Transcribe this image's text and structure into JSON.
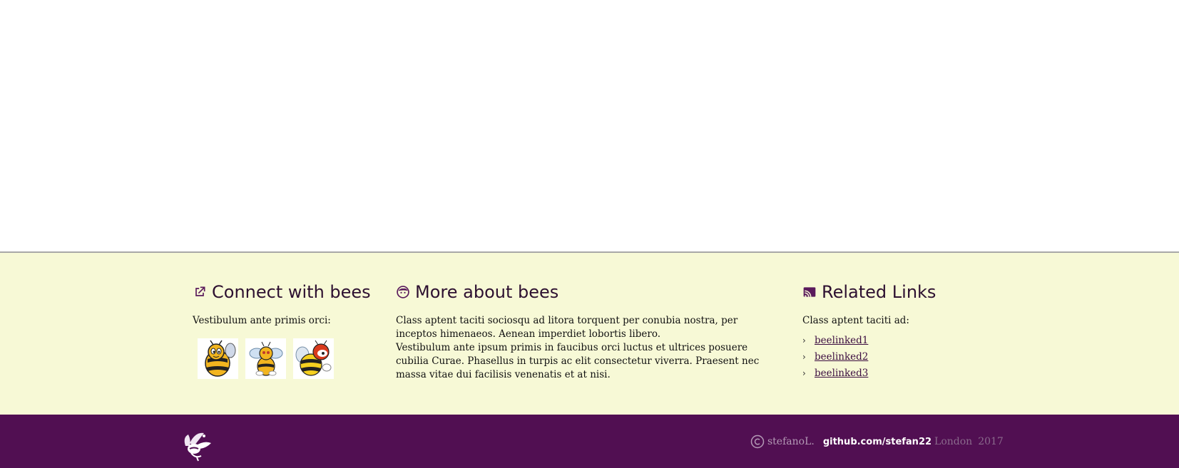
{
  "colors": {
    "footer_top_bg": "#f7f9d6",
    "footer_bottom_bg": "#510f52",
    "heading_color": "#2d1030",
    "link_color": "#3b0c40"
  },
  "connect": {
    "icon": "external-link-icon",
    "heading": "Connect with bees",
    "text": "Vestibulum ante primis orci:",
    "images": [
      "bee-image-1",
      "bee-image-2",
      "bee-image-3"
    ]
  },
  "about": {
    "icon": "face-icon",
    "heading": "More about bees",
    "paragraph1": "Class aptent taciti sociosqu ad litora torquent per conubia nostra, per inceptos himenaeos. Aenean imperdiet lobortis libero.",
    "paragraph2": "Vestibulum ante ipsum primis in faucibus orci luctus et ultrices posuere cubilia Curae. Phasellus in turpis ac elit consectetur viverra. Praesent nec massa vitae dui facilisis venenatis et at nisi."
  },
  "related": {
    "icon": "cast-icon",
    "heading": "Related Links",
    "text": "Class aptent taciti ad:",
    "links": [
      "beelinked1",
      "beelinked2",
      "beelinked3"
    ]
  },
  "bottom": {
    "logo": "bee-logo-icon",
    "author": "stefanoL.",
    "github": "github.com/stefan22",
    "city": "London",
    "year": "2017"
  }
}
